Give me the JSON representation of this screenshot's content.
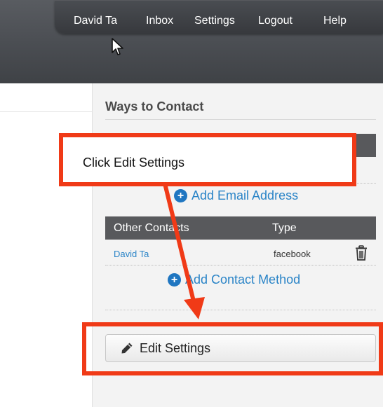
{
  "nav": {
    "user": "David Ta",
    "inbox": "Inbox",
    "settings": "Settings",
    "logout": "Logout",
    "help": "Help"
  },
  "panel": {
    "title": "Ways to Contact",
    "add_email_label": "Add Email Address",
    "other_contacts": {
      "headers": [
        "Other Contacts",
        "Type"
      ],
      "rows": [
        {
          "name": "David Ta",
          "type": "facebook"
        }
      ]
    },
    "add_contact_label": "Add Contact Method",
    "edit_settings_label": "Edit Settings"
  },
  "annotation": {
    "callout_text": "Click Edit Settings"
  },
  "colors": {
    "accent_red": "#f03a17",
    "link_blue": "#2a84c7",
    "header_dark": "#4a4d52",
    "table_header": "#58595c"
  },
  "icons": [
    "cursor-icon",
    "plus-circle-icon",
    "trash-icon",
    "pencil-icon"
  ]
}
